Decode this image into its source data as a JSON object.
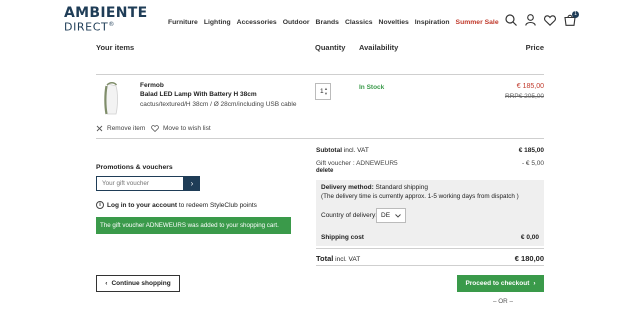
{
  "brand": {
    "name_line1": "AMBIENTE",
    "name_line2": "DIRECT",
    "registered": "®"
  },
  "nav": [
    {
      "label": "Furniture"
    },
    {
      "label": "Lighting"
    },
    {
      "label": "Accessories"
    },
    {
      "label": "Outdoor"
    },
    {
      "label": "Brands"
    },
    {
      "label": "Classics"
    },
    {
      "label": "Novelties"
    },
    {
      "label": "Inspiration"
    },
    {
      "label": "Summer Sale"
    }
  ],
  "header_icons": {
    "search": "search-icon",
    "account": "user-icon",
    "wishlist": "heart-icon",
    "cart": "cart-icon",
    "cart_count": "1"
  },
  "table_header": {
    "items": "Your items",
    "quantity": "Quantity",
    "availability": "Availability",
    "price": "Price"
  },
  "item": {
    "brand": "Fermob",
    "name": "Balad LED Lamp With Battery H 38cm",
    "variant": "cactus/textured/H 38cm / Ø 28cm/including USB cable",
    "quantity": "1",
    "availability": "In Stock",
    "price": "€ 185,00",
    "rrp": "RRP€ 205,00",
    "remove_label": "Remove item",
    "wishlist_label": "Move to wish list"
  },
  "promotions": {
    "title": "Promotions & vouchers",
    "input_placeholder": "Your gift voucher",
    "submit_glyph": "›",
    "login_link": "Log in to your account",
    "login_rest": " to redeem StyleClub points",
    "success_message": "The gift voucher ADNEWEURS was added to your shopping cart."
  },
  "summary": {
    "subtotal_label": "Subtotal",
    "subtotal_suffix": " incl. VAT",
    "subtotal_value": "€ 185,00",
    "voucher_label": "Gift voucher : ADNEWEUR5",
    "voucher_value": "- € 5,00",
    "delete_label": "delete",
    "delivery_method_label": "Delivery method:",
    "delivery_method_value": " Standard shipping",
    "delivery_note": "(The delivery time is currently approx. 1-5 working days from dispatch )",
    "country_label": "Country of delivery:",
    "country_value": "DE",
    "shipping_label": "Shipping cost",
    "shipping_value": "€ 0,00",
    "total_label": "Total",
    "total_suffix": " incl. VAT",
    "total_value": "€ 180,00"
  },
  "actions": {
    "continue_label": "Continue shopping",
    "checkout_label": "Proceed to checkout",
    "or_label": "– OR –"
  },
  "colors": {
    "brand_blue": "#1f3d57",
    "success_green": "#3a9a4a",
    "sale_red": "#c0392b",
    "panel_grey": "#efefef"
  }
}
